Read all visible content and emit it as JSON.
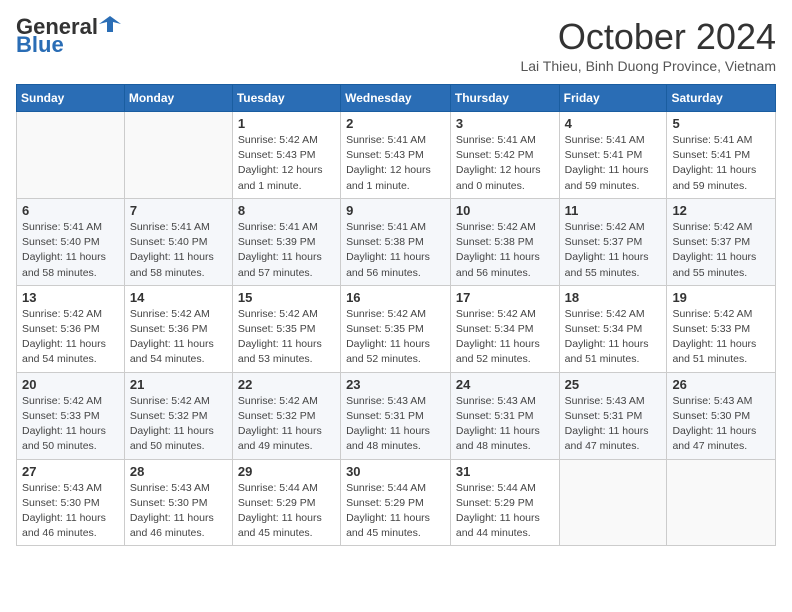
{
  "header": {
    "logo_general": "General",
    "logo_blue": "Blue",
    "month_title": "October 2024",
    "subtitle": "Lai Thieu, Binh Duong Province, Vietnam"
  },
  "days_of_week": [
    "Sunday",
    "Monday",
    "Tuesday",
    "Wednesday",
    "Thursday",
    "Friday",
    "Saturday"
  ],
  "weeks": [
    [
      {
        "day": "",
        "sunrise": "",
        "sunset": "",
        "daylight": ""
      },
      {
        "day": "",
        "sunrise": "",
        "sunset": "",
        "daylight": ""
      },
      {
        "day": "1",
        "sunrise": "Sunrise: 5:42 AM",
        "sunset": "Sunset: 5:43 PM",
        "daylight": "Daylight: 12 hours and 1 minute."
      },
      {
        "day": "2",
        "sunrise": "Sunrise: 5:41 AM",
        "sunset": "Sunset: 5:43 PM",
        "daylight": "Daylight: 12 hours and 1 minute."
      },
      {
        "day": "3",
        "sunrise": "Sunrise: 5:41 AM",
        "sunset": "Sunset: 5:42 PM",
        "daylight": "Daylight: 12 hours and 0 minutes."
      },
      {
        "day": "4",
        "sunrise": "Sunrise: 5:41 AM",
        "sunset": "Sunset: 5:41 PM",
        "daylight": "Daylight: 11 hours and 59 minutes."
      },
      {
        "day": "5",
        "sunrise": "Sunrise: 5:41 AM",
        "sunset": "Sunset: 5:41 PM",
        "daylight": "Daylight: 11 hours and 59 minutes."
      }
    ],
    [
      {
        "day": "6",
        "sunrise": "Sunrise: 5:41 AM",
        "sunset": "Sunset: 5:40 PM",
        "daylight": "Daylight: 11 hours and 58 minutes."
      },
      {
        "day": "7",
        "sunrise": "Sunrise: 5:41 AM",
        "sunset": "Sunset: 5:40 PM",
        "daylight": "Daylight: 11 hours and 58 minutes."
      },
      {
        "day": "8",
        "sunrise": "Sunrise: 5:41 AM",
        "sunset": "Sunset: 5:39 PM",
        "daylight": "Daylight: 11 hours and 57 minutes."
      },
      {
        "day": "9",
        "sunrise": "Sunrise: 5:41 AM",
        "sunset": "Sunset: 5:38 PM",
        "daylight": "Daylight: 11 hours and 56 minutes."
      },
      {
        "day": "10",
        "sunrise": "Sunrise: 5:42 AM",
        "sunset": "Sunset: 5:38 PM",
        "daylight": "Daylight: 11 hours and 56 minutes."
      },
      {
        "day": "11",
        "sunrise": "Sunrise: 5:42 AM",
        "sunset": "Sunset: 5:37 PM",
        "daylight": "Daylight: 11 hours and 55 minutes."
      },
      {
        "day": "12",
        "sunrise": "Sunrise: 5:42 AM",
        "sunset": "Sunset: 5:37 PM",
        "daylight": "Daylight: 11 hours and 55 minutes."
      }
    ],
    [
      {
        "day": "13",
        "sunrise": "Sunrise: 5:42 AM",
        "sunset": "Sunset: 5:36 PM",
        "daylight": "Daylight: 11 hours and 54 minutes."
      },
      {
        "day": "14",
        "sunrise": "Sunrise: 5:42 AM",
        "sunset": "Sunset: 5:36 PM",
        "daylight": "Daylight: 11 hours and 54 minutes."
      },
      {
        "day": "15",
        "sunrise": "Sunrise: 5:42 AM",
        "sunset": "Sunset: 5:35 PM",
        "daylight": "Daylight: 11 hours and 53 minutes."
      },
      {
        "day": "16",
        "sunrise": "Sunrise: 5:42 AM",
        "sunset": "Sunset: 5:35 PM",
        "daylight": "Daylight: 11 hours and 52 minutes."
      },
      {
        "day": "17",
        "sunrise": "Sunrise: 5:42 AM",
        "sunset": "Sunset: 5:34 PM",
        "daylight": "Daylight: 11 hours and 52 minutes."
      },
      {
        "day": "18",
        "sunrise": "Sunrise: 5:42 AM",
        "sunset": "Sunset: 5:34 PM",
        "daylight": "Daylight: 11 hours and 51 minutes."
      },
      {
        "day": "19",
        "sunrise": "Sunrise: 5:42 AM",
        "sunset": "Sunset: 5:33 PM",
        "daylight": "Daylight: 11 hours and 51 minutes."
      }
    ],
    [
      {
        "day": "20",
        "sunrise": "Sunrise: 5:42 AM",
        "sunset": "Sunset: 5:33 PM",
        "daylight": "Daylight: 11 hours and 50 minutes."
      },
      {
        "day": "21",
        "sunrise": "Sunrise: 5:42 AM",
        "sunset": "Sunset: 5:32 PM",
        "daylight": "Daylight: 11 hours and 50 minutes."
      },
      {
        "day": "22",
        "sunrise": "Sunrise: 5:42 AM",
        "sunset": "Sunset: 5:32 PM",
        "daylight": "Daylight: 11 hours and 49 minutes."
      },
      {
        "day": "23",
        "sunrise": "Sunrise: 5:43 AM",
        "sunset": "Sunset: 5:31 PM",
        "daylight": "Daylight: 11 hours and 48 minutes."
      },
      {
        "day": "24",
        "sunrise": "Sunrise: 5:43 AM",
        "sunset": "Sunset: 5:31 PM",
        "daylight": "Daylight: 11 hours and 48 minutes."
      },
      {
        "day": "25",
        "sunrise": "Sunrise: 5:43 AM",
        "sunset": "Sunset: 5:31 PM",
        "daylight": "Daylight: 11 hours and 47 minutes."
      },
      {
        "day": "26",
        "sunrise": "Sunrise: 5:43 AM",
        "sunset": "Sunset: 5:30 PM",
        "daylight": "Daylight: 11 hours and 47 minutes."
      }
    ],
    [
      {
        "day": "27",
        "sunrise": "Sunrise: 5:43 AM",
        "sunset": "Sunset: 5:30 PM",
        "daylight": "Daylight: 11 hours and 46 minutes."
      },
      {
        "day": "28",
        "sunrise": "Sunrise: 5:43 AM",
        "sunset": "Sunset: 5:30 PM",
        "daylight": "Daylight: 11 hours and 46 minutes."
      },
      {
        "day": "29",
        "sunrise": "Sunrise: 5:44 AM",
        "sunset": "Sunset: 5:29 PM",
        "daylight": "Daylight: 11 hours and 45 minutes."
      },
      {
        "day": "30",
        "sunrise": "Sunrise: 5:44 AM",
        "sunset": "Sunset: 5:29 PM",
        "daylight": "Daylight: 11 hours and 45 minutes."
      },
      {
        "day": "31",
        "sunrise": "Sunrise: 5:44 AM",
        "sunset": "Sunset: 5:29 PM",
        "daylight": "Daylight: 11 hours and 44 minutes."
      },
      {
        "day": "",
        "sunrise": "",
        "sunset": "",
        "daylight": ""
      },
      {
        "day": "",
        "sunrise": "",
        "sunset": "",
        "daylight": ""
      }
    ]
  ]
}
